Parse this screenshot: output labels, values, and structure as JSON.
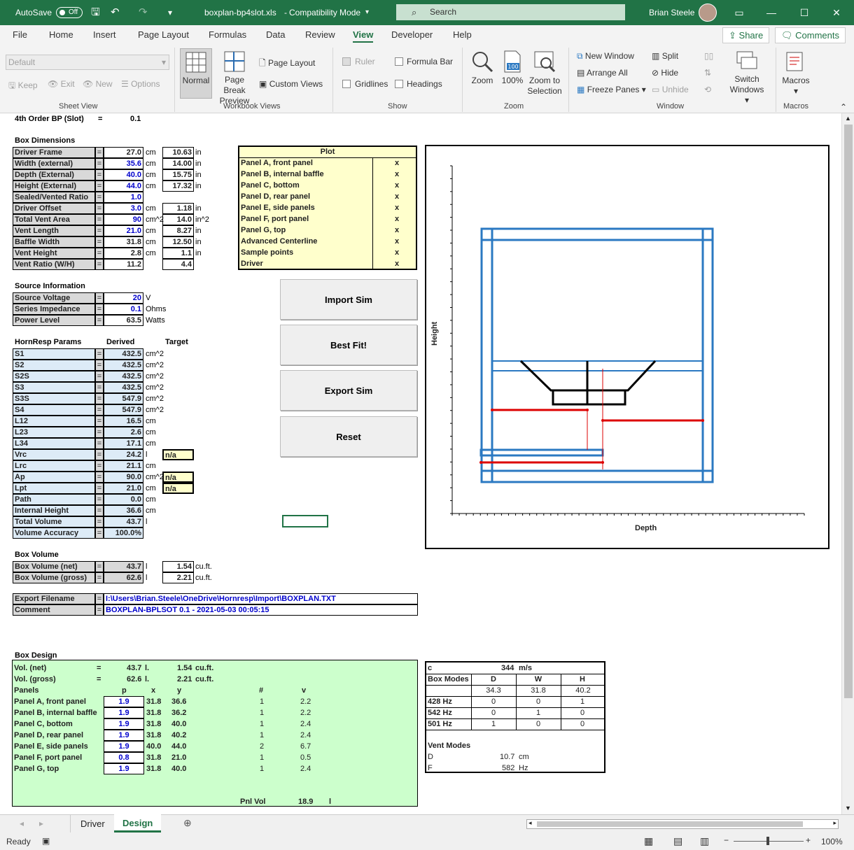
{
  "titlebar": {
    "autosave": "AutoSave",
    "toggle": "Off",
    "filename": "boxplan-bp4slot.xls",
    "mode": "Compatibility Mode",
    "search": "Search",
    "user": "Brian Steele"
  },
  "menu": [
    "File",
    "Home",
    "Insert",
    "Page Layout",
    "Formulas",
    "Data",
    "Review",
    "View",
    "Developer",
    "Help"
  ],
  "share": "Share",
  "comments": "Comments",
  "ribbon": {
    "sheetview": {
      "dropdown": "Default",
      "keep": "Keep",
      "exit": "Exit",
      "new": "New",
      "options": "Options",
      "group": "Sheet View"
    },
    "workbook": {
      "normal": "Normal",
      "pagebreak": "Page Break Preview",
      "pagelayout": "Page Layout",
      "customviews": "Custom Views",
      "group": "Workbook Views"
    },
    "show": {
      "ruler": "Ruler",
      "formulabar": "Formula Bar",
      "gridlines": "Gridlines",
      "headings": "Headings",
      "group": "Show"
    },
    "zoom": {
      "zoom": "Zoom",
      "hundred": "100%",
      "tosel": "Zoom to Selection",
      "group": "Zoom"
    },
    "window": {
      "newwin": "New Window",
      "arrange": "Arrange All",
      "freeze": "Freeze Panes",
      "split": "Split",
      "hide": "Hide",
      "unhide": "Unhide",
      "switch": "Switch Windows",
      "group": "Window"
    },
    "macros": {
      "macros": "Macros",
      "group": "Macros"
    }
  },
  "sheet": {
    "top_label": "4th Order BP (Slot)",
    "top_eq": "=",
    "top_val": "0.1",
    "boxdim_title": "Box Dimensions",
    "boxdim": [
      {
        "label": "Driver Frame",
        "val": "27.0",
        "unit": "cm",
        "in": "10.63",
        "inunit": "in",
        "blue": false
      },
      {
        "label": "Width (external)",
        "val": "35.6",
        "unit": "cm",
        "in": "14.00",
        "inunit": "in",
        "blue": true
      },
      {
        "label": "Depth (External)",
        "val": "40.0",
        "unit": "cm",
        "in": "15.75",
        "inunit": "in",
        "blue": true
      },
      {
        "label": "Height (External)",
        "val": "44.0",
        "unit": "cm",
        "in": "17.32",
        "inunit": "in",
        "blue": true
      },
      {
        "label": "Sealed/Vented Ratio",
        "val": "1.0",
        "unit": "",
        "in": "",
        "inunit": "",
        "blue": true
      },
      {
        "label": "Driver Offset",
        "val": "3.0",
        "unit": "cm",
        "in": "1.18",
        "inunit": "in",
        "blue": true
      },
      {
        "label": "Total Vent Area",
        "val": "90",
        "unit": "cm^2",
        "in": "14.0",
        "inunit": "in^2",
        "blue": true
      },
      {
        "label": "Vent Length",
        "val": "21.0",
        "unit": "cm",
        "in": "8.27",
        "inunit": "in",
        "blue": true
      },
      {
        "label": "Baffle Width",
        "val": "31.8",
        "unit": "cm",
        "in": "12.50",
        "inunit": "in",
        "blue": false
      },
      {
        "label": "Vent Height",
        "val": "2.8",
        "unit": "cm",
        "in": "1.1",
        "inunit": "in",
        "blue": false
      },
      {
        "label": "Vent Ratio (W/H)",
        "val": "11.2",
        "unit": "",
        "in": "4.4",
        "inunit": "",
        "blue": false
      }
    ],
    "plot_title": "Plot",
    "plot": [
      {
        "name": "Panel A, front panel",
        "x": "x"
      },
      {
        "name": "Panel B, internal baffle",
        "x": "x"
      },
      {
        "name": "Panel C, bottom",
        "x": "x"
      },
      {
        "name": "Panel D, rear panel",
        "x": "x"
      },
      {
        "name": "Panel E, side panels",
        "x": "x"
      },
      {
        "name": "Panel F, port panel",
        "x": "x"
      },
      {
        "name": "Panel G, top",
        "x": "x"
      },
      {
        "name": "Advanced Centerline",
        "x": "x"
      },
      {
        "name": "Sample points",
        "x": "x"
      },
      {
        "name": "Driver",
        "x": "x"
      }
    ],
    "source_title": "Source Information",
    "source": [
      {
        "label": "Source Voltage",
        "val": "20",
        "unit": "V",
        "blue": true
      },
      {
        "label": "Series Impedance",
        "val": "0.1",
        "unit": "Ohms",
        "blue": true
      },
      {
        "label": "Power Level",
        "val": "63.5",
        "unit": "Watts",
        "blue": false
      }
    ],
    "buttons": [
      "Import Sim",
      "Best Fit!",
      "Export Sim",
      "Reset"
    ],
    "hr_title": "HornResp Params",
    "hr_derived": "Derived",
    "hr_target": "Target",
    "hr": [
      {
        "label": "S1",
        "val": "432.5",
        "unit": "cm^2",
        "target": ""
      },
      {
        "label": "S2",
        "val": "432.5",
        "unit": "cm^2",
        "target": ""
      },
      {
        "label": "S2S",
        "val": "432.5",
        "unit": "cm^2",
        "target": ""
      },
      {
        "label": "S3",
        "val": "432.5",
        "unit": "cm^2",
        "target": ""
      },
      {
        "label": "S3S",
        "val": "547.9",
        "unit": "cm^2",
        "target": ""
      },
      {
        "label": "S4",
        "val": "547.9",
        "unit": "cm^2",
        "target": ""
      },
      {
        "label": "L12",
        "val": "16.5",
        "unit": "cm",
        "target": ""
      },
      {
        "label": "L23",
        "val": "2.6",
        "unit": "cm",
        "target": ""
      },
      {
        "label": "L34",
        "val": "17.1",
        "unit": "cm",
        "target": ""
      },
      {
        "label": "Vrc",
        "val": "24.2",
        "unit": "l",
        "target": "n/a"
      },
      {
        "label": "Lrc",
        "val": "21.1",
        "unit": "cm",
        "target": ""
      },
      {
        "label": "Ap",
        "val": "90.0",
        "unit": "cm^2",
        "target": "n/a"
      },
      {
        "label": "Lpt",
        "val": "21.0",
        "unit": "cm",
        "target": "n/a"
      },
      {
        "label": "Path",
        "val": "0.0",
        "unit": "cm",
        "target": ""
      },
      {
        "label": "Internal Height",
        "val": "36.6",
        "unit": "cm",
        "target": ""
      },
      {
        "label": "Total Volume",
        "val": "43.7",
        "unit": "l",
        "target": ""
      },
      {
        "label": "Volume Accuracy",
        "val": "100.0%",
        "unit": "",
        "target": ""
      }
    ],
    "boxvol_title": "Box Volume",
    "boxvol": [
      {
        "label": "Box Volume (net)",
        "val": "43.7",
        "unit": "l",
        "cuft": "1.54",
        "cuunit": "cu.ft."
      },
      {
        "label": "Box Volume (gross)",
        "val": "62.6",
        "unit": "l",
        "cuft": "2.21",
        "cuunit": "cu.ft."
      }
    ],
    "export_label": "Export Filename",
    "export_val": "I:\\Users\\Brian.Steele\\OneDrive\\Hornresp\\Import\\BOXPLAN.TXT",
    "comment_label": "Comment",
    "comment_val": "BOXPLAN-BPLSOT 0.1 - 2021-05-03 00:05:15",
    "chart": {
      "ylabel": "Height",
      "xlabel": "Depth"
    },
    "design_title": "Box Design",
    "design": {
      "vol_net": {
        "label": "Vol. (net)",
        "eq": "=",
        "val": "43.7",
        "u": "l.",
        "cuft": "1.54",
        "cu": "cu.ft."
      },
      "vol_gross": {
        "label": "Vol. (gross)",
        "eq": "=",
        "val": "62.6",
        "u": "l.",
        "cuft": "2.21",
        "cu": "cu.ft."
      },
      "head": {
        "panels": "Panels",
        "p": "p",
        "x": "x",
        "y": "y",
        "n": "#",
        "v": "v"
      },
      "rows": [
        {
          "name": "Panel A, front panel",
          "p": "1.9",
          "x": "31.8",
          "y": "36.6",
          "n": "1",
          "v": "2.2"
        },
        {
          "name": "Panel B, internal baffle",
          "p": "1.9",
          "x": "31.8",
          "y": "36.2",
          "n": "1",
          "v": "2.2"
        },
        {
          "name": "Panel C, bottom",
          "p": "1.9",
          "x": "31.8",
          "y": "40.0",
          "n": "1",
          "v": "2.4"
        },
        {
          "name": "Panel D, rear panel",
          "p": "1.9",
          "x": "31.8",
          "y": "40.2",
          "n": "1",
          "v": "2.4"
        },
        {
          "name": "Panel E, side panels",
          "p": "1.9",
          "x": "40.0",
          "y": "44.0",
          "n": "2",
          "v": "6.7"
        },
        {
          "name": "Panel F, port panel",
          "p": "0.8",
          "x": "31.8",
          "y": "21.0",
          "n": "1",
          "v": "0.5"
        },
        {
          "name": "Panel G, top",
          "p": "1.9",
          "x": "31.8",
          "y": "40.0",
          "n": "1",
          "v": "2.4"
        }
      ],
      "pnl_label": "Pnl Vol",
      "pnl_val": "18.9",
      "pnl_unit": "l"
    },
    "modes": {
      "c": "c",
      "c_val": "344",
      "c_unit": "m/s",
      "head": [
        "Box Modes",
        "D",
        "W",
        "H"
      ],
      "dims": [
        "34.3",
        "31.8",
        "40.2"
      ],
      "rows": [
        [
          "428 Hz",
          "0",
          "0",
          "1"
        ],
        [
          "542 Hz",
          "0",
          "1",
          "0"
        ],
        [
          "501 Hz",
          "1",
          "0",
          "0"
        ]
      ],
      "vent_title": "Vent Modes",
      "vent": [
        [
          "D",
          "10.7",
          "cm"
        ],
        [
          "F",
          "582",
          "Hz"
        ]
      ]
    }
  },
  "tabs": [
    "Driver",
    "Design"
  ],
  "status": {
    "ready": "Ready",
    "zoom": "100%"
  }
}
